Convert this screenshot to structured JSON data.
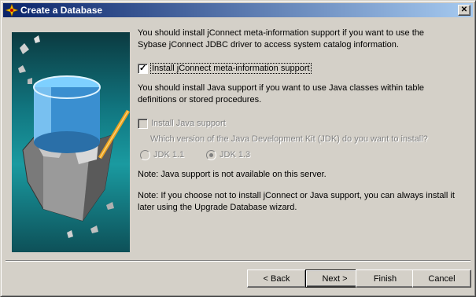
{
  "window": {
    "title": "Create a Database",
    "close_label": "✕"
  },
  "main": {
    "para1": "You should install jConnect meta-information support if you want to use the Sybase jConnect JDBC driver to access system catalog information.",
    "jconnect_checkbox": {
      "label": "Install jConnect meta-information support",
      "checked": true
    },
    "para2": "You should install Java support if you want to use Java classes within table definitions or stored procedures.",
    "java_checkbox": {
      "label": "Install Java support",
      "checked": false,
      "disabled": true
    },
    "jdk_question": "Which version of the Java Development Kit (JDK) do you want to install?",
    "jdk_options": [
      {
        "label": "JDK 1.1",
        "selected": false
      },
      {
        "label": "JDK 1.3",
        "selected": true
      }
    ],
    "note1": "Note: Java support is not available on this server.",
    "note2": "Note: If you choose not to install jConnect or Java support, you can always install it later using the Upgrade Database wizard."
  },
  "buttons": {
    "back": "< Back",
    "next": "Next >",
    "finish": "Finish",
    "cancel": "Cancel"
  },
  "colors": {
    "titlebar_start": "#0a246a",
    "titlebar_end": "#a6caf0",
    "dialog_bg": "#d4d0c8"
  }
}
